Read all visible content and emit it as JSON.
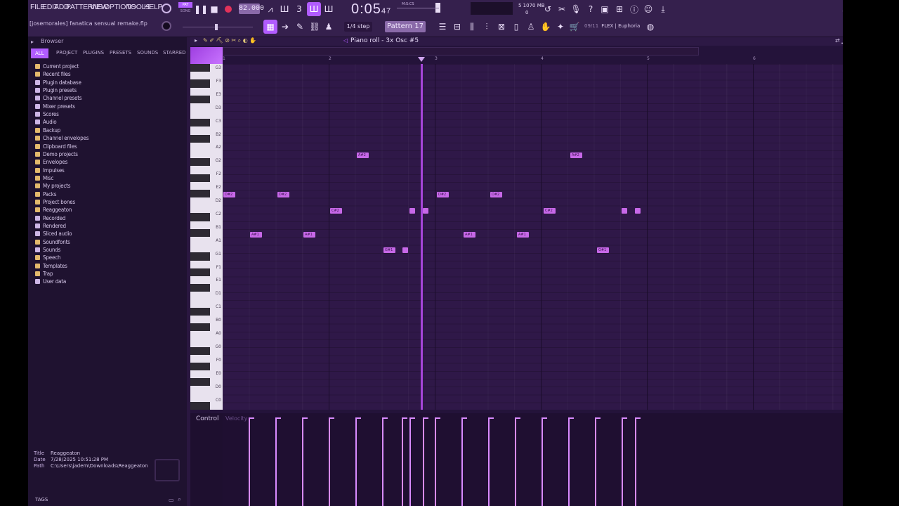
{
  "menu": [
    "FILE",
    "EDIT",
    "ADD",
    "PATTERNS",
    "VIEW",
    "OPTIONS",
    "TOOLS",
    "HELP"
  ],
  "transport": {
    "pat_label": "PAT",
    "song_label": "SONG",
    "tempo": "82.000",
    "time": "0:05",
    "time_fraction": "47",
    "time_units": "M:S:CS"
  },
  "project": {
    "title": "[josemorales] fanatica sensual remake.flp"
  },
  "memory": {
    "line1": "5     1070 MB",
    "line2": "0"
  },
  "snap": "1/4 step",
  "pattern": "Pattern 17",
  "news": {
    "count": "09/11",
    "text": "FLEX | Euphoria"
  },
  "browser": {
    "title": "Browser",
    "tabs": [
      "ALL",
      "PROJECT",
      "PLUGINS",
      "PRESETS",
      "SOUNDS",
      "STARRED"
    ],
    "items": [
      "Current project",
      "Recent files",
      "Plugin database",
      "Plugin presets",
      "Channel presets",
      "Mixer presets",
      "Scores",
      "Audio",
      "Backup",
      "Channel envelopes",
      "Clipboard files",
      "Demo projects",
      "Envelopes",
      "Impulses",
      "Misc",
      "My projects",
      "Packs",
      "Project bones",
      "Reaggeaton",
      "Recorded",
      "Rendered",
      "Sliced audio",
      "Soundfonts",
      "Sounds",
      "Speech",
      "Templates",
      "Trap",
      "User data"
    ],
    "meta": {
      "title_key": "Title",
      "title_val": "Reaggeaton",
      "date_key": "Date",
      "date_val": "7/28/2025 10:51:28 PM",
      "path_key": "Path",
      "path_val": "C:\\Users\\jadem\\Downloads\\Reaggeaton"
    },
    "tags": "TAGS"
  },
  "piano_roll": {
    "title": "Piano roll - 3x Osc #5",
    "bars": [
      "1",
      "2",
      "3",
      "4",
      "5",
      "6"
    ],
    "key_labels": [
      "G3",
      "F3",
      "E3",
      "D3",
      "C3",
      "B2",
      "A2",
      "G2",
      "F2",
      "E2",
      "D2",
      "C2",
      "B1",
      "A1",
      "G1",
      "F1",
      "E1",
      "D1",
      "C1",
      "B0",
      "A0",
      "G0",
      "F0",
      "E0",
      "D0",
      "C0"
    ],
    "notes": [
      "D#2",
      "D#2",
      "A#1",
      "A#1",
      "C#2",
      "A#2",
      "G#1",
      "D#2",
      "D#2",
      "A#1",
      "A#1",
      "C#2",
      "A#2",
      "G#1"
    ],
    "control_label": "Control",
    "velocity_label": "Velocity"
  }
}
